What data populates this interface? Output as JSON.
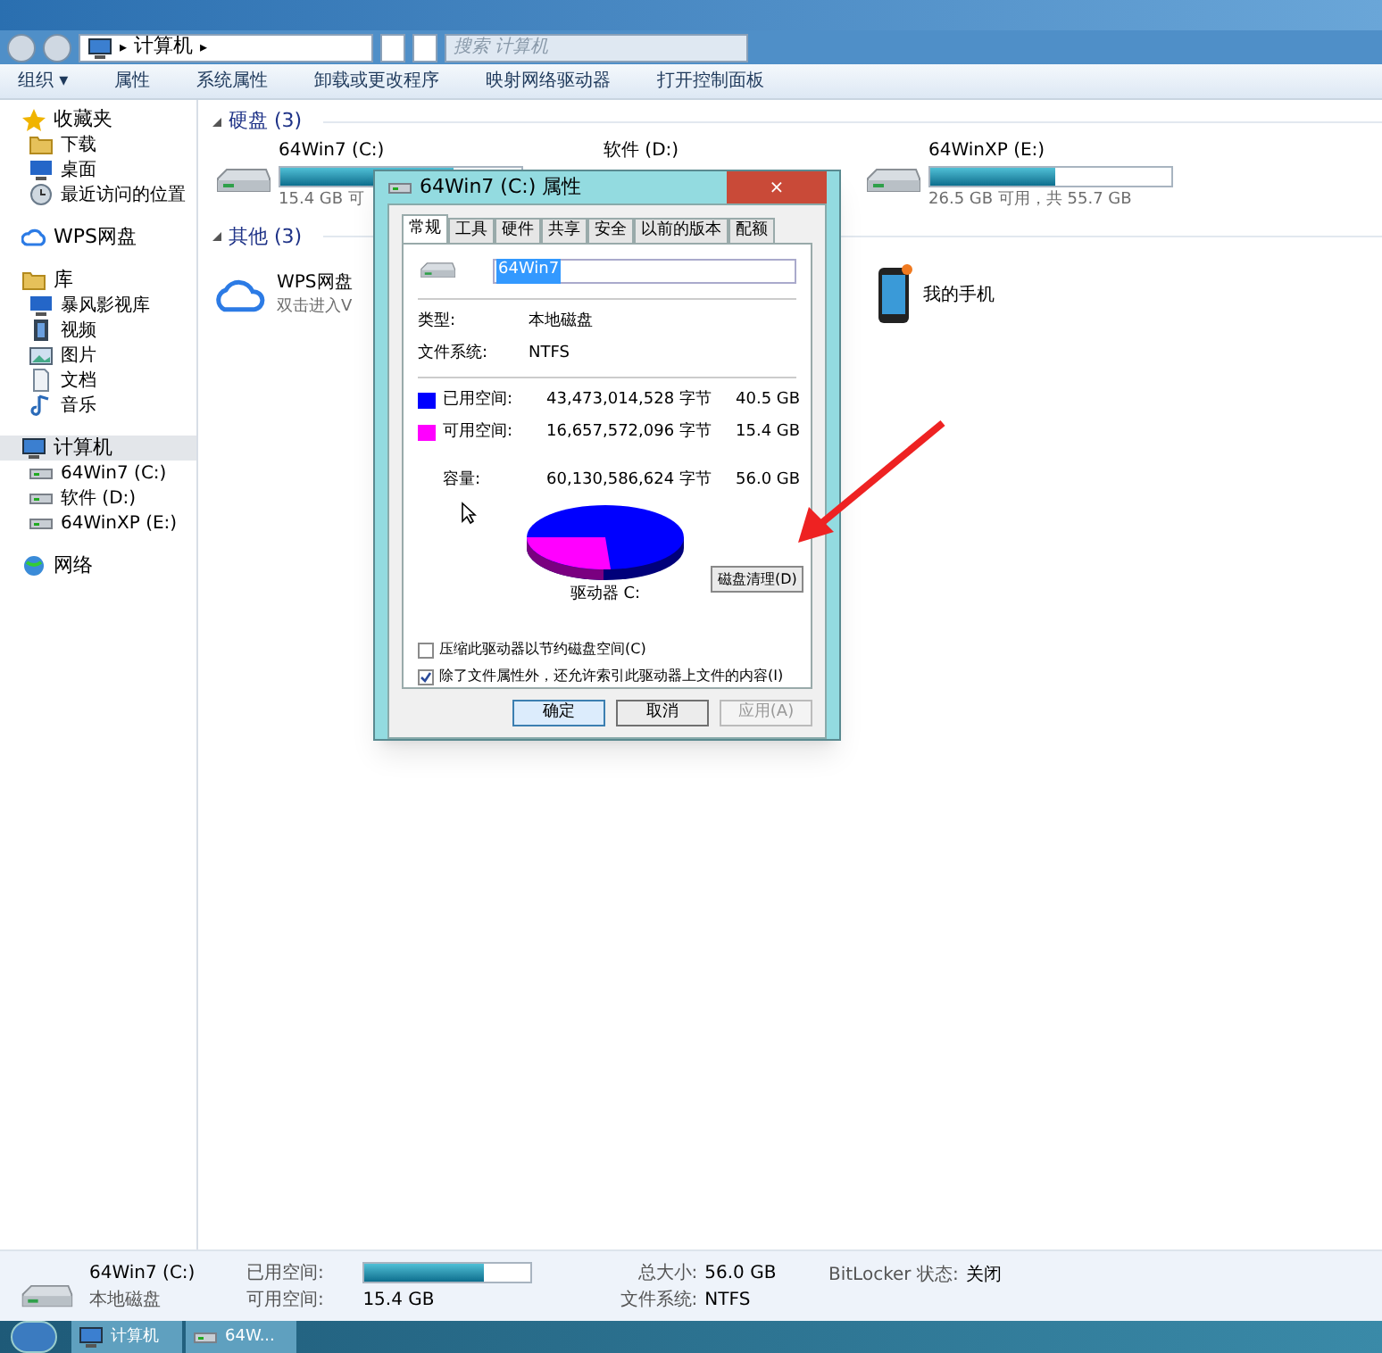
{
  "address_bar": {
    "path": "计算机",
    "separator": "▸",
    "search_placeholder": "搜索 计算机"
  },
  "toolbar": [
    "组织 ▾",
    "属性",
    "系统属性",
    "卸载或更改程序",
    "映射网络驱动器",
    "打开控制面板"
  ],
  "sidebar": {
    "groups": [
      {
        "label": "收藏夹",
        "selected": false,
        "children": [
          {
            "label": "下载"
          },
          {
            "label": "桌面"
          },
          {
            "label": "最近访问的位置"
          }
        ]
      },
      {
        "label": "WPS网盘",
        "selected": false
      },
      {
        "label": "库",
        "selected": false,
        "children": [
          {
            "label": "暴风影视库"
          },
          {
            "label": "视频"
          },
          {
            "label": "图片"
          },
          {
            "label": "文档"
          },
          {
            "label": "音乐"
          }
        ]
      },
      {
        "label": "计算机",
        "selected": true,
        "children": [
          {
            "label": "64Win7  (C:)"
          },
          {
            "label": "软件 (D:)"
          },
          {
            "label": "64WinXP  (E:)"
          }
        ]
      },
      {
        "label": "网络",
        "selected": false
      }
    ]
  },
  "hard_disks": {
    "heading": "硬盘 (3)",
    "drives": [
      {
        "name": "64Win7  (C:)",
        "level": 0.72,
        "free": "15.4 GB 可"
      },
      {
        "name": "软件 (D:)"
      },
      {
        "name": "64WinXP  (E:)",
        "level": 0.52,
        "free": "26.5 GB 可用，共 55.7 GB"
      }
    ]
  },
  "other": {
    "heading": "其他 (3)",
    "items": [
      {
        "kind": "cloud",
        "name": "WPS网盘",
        "subtitle": "双击进入V"
      },
      {
        "kind": "phone",
        "name": "我的手机"
      }
    ]
  },
  "dialog": {
    "title": "64Win7  (C:) 属性",
    "close": "×",
    "tabs": [
      {
        "label": "常规",
        "selected": true
      },
      {
        "label": "工具",
        "selected": false
      },
      {
        "label": "硬件",
        "selected": false
      },
      {
        "label": "共享",
        "selected": false
      },
      {
        "label": "安全",
        "selected": false
      },
      {
        "label": "以前的版本",
        "selected": false
      },
      {
        "label": "配额",
        "selected": false
      }
    ],
    "name_value": "64Win7",
    "info": [
      {
        "label": "类型:",
        "value": "本地磁盘"
      },
      {
        "label": "文件系统:",
        "value": "NTFS"
      }
    ],
    "space": [
      {
        "label": "已用空间:",
        "bytes": "43,473,014,528",
        "unit": "字节",
        "size": "40.5 GB",
        "color": "#0000ff"
      },
      {
        "label": "可用空间:",
        "bytes": "16,657,572,096",
        "unit": "字节",
        "size": "15.4 GB",
        "color": "#ff00ff"
      }
    ],
    "capacity": {
      "label": "容量:",
      "bytes": "60,130,586,624",
      "unit": "字节",
      "size": "56.0 GB"
    },
    "drive_label": "驱动器 C:",
    "cleanup_button": "磁盘清理(D)",
    "options": [
      {
        "label": "压缩此驱动器以节约磁盘空间(C)",
        "checked": false
      },
      {
        "label": "除了文件属性外，还允许索引此驱动器上文件的内容(I)",
        "checked": true
      }
    ],
    "buttons": [
      {
        "label": "确定",
        "disabled": false
      },
      {
        "label": "取消",
        "disabled": false
      },
      {
        "label": "应用(A)",
        "disabled": true
      }
    ]
  },
  "details": {
    "name": "64Win7  (C:)",
    "type": "本地磁盘",
    "used_label": "已用空间:",
    "level": 0.72,
    "free_label": "可用空间:",
    "free": "15.4 GB",
    "total_label": "总大小:",
    "total": "56.0 GB",
    "fs_label": "文件系统:",
    "fs": "NTFS",
    "bitlocker_label": "BitLocker 状态:",
    "bitlocker": "关闭"
  },
  "taskbar": {
    "items": [
      "计算机",
      "64W..."
    ]
  }
}
